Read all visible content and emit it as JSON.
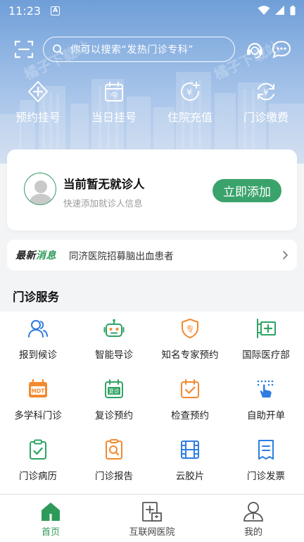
{
  "status_bar": {
    "time": "11:23",
    "notif": "A"
  },
  "header": {
    "search_placeholder": "你可以搜索“发热门诊专科”",
    "icons": [
      "scan-icon",
      "customer-service-icon",
      "message-icon"
    ]
  },
  "quick_actions": [
    {
      "label": "预约挂号",
      "icon": "appointment-plus-icon"
    },
    {
      "label": "当日挂号",
      "icon": "calendar-today-icon"
    },
    {
      "label": "住院充值",
      "icon": "yuan-plus-icon"
    },
    {
      "label": "门诊缴费",
      "icon": "yuan-refresh-icon"
    }
  ],
  "patient_card": {
    "title": "当前暂无就诊人",
    "subtitle": "快速添加就诊人信息",
    "button": "立即添加"
  },
  "news": {
    "tag_a": "最新",
    "tag_b": "消息",
    "text": "同济医院招募脑出血患者"
  },
  "section": {
    "title": "门诊服务"
  },
  "services": [
    {
      "label": "报到候诊",
      "icon": "users-icon"
    },
    {
      "label": "智能导诊",
      "icon": "robot-icon"
    },
    {
      "label": "知名专家预约",
      "icon": "expert-shield-icon"
    },
    {
      "label": "国际医疗部",
      "icon": "international-clinic-icon"
    },
    {
      "label": "多学科门诊",
      "icon": "mdt-calendar-icon"
    },
    {
      "label": "复诊预约",
      "icon": "follow-up-icon"
    },
    {
      "label": "检查预约",
      "icon": "calendar-check-icon"
    },
    {
      "label": "自助开单",
      "icon": "hand-tap-icon"
    },
    {
      "label": "门诊病历",
      "icon": "clipboard-check-icon"
    },
    {
      "label": "门诊报告",
      "icon": "report-search-icon"
    },
    {
      "label": "云胶片",
      "icon": "film-icon"
    },
    {
      "label": "门诊发票",
      "icon": "invoice-icon"
    }
  ],
  "bottom_nav": [
    {
      "label": "首页",
      "icon": "home-icon",
      "active": true
    },
    {
      "label": "互联网医院",
      "icon": "internet-hospital-icon",
      "active": false
    },
    {
      "label": "我的",
      "icon": "profile-icon",
      "active": false
    }
  ],
  "colors": {
    "brand_green": "#3aa36b",
    "blue": "#2f7de1",
    "orange": "#f28a2f"
  },
  "watermark": "橘子下载站"
}
